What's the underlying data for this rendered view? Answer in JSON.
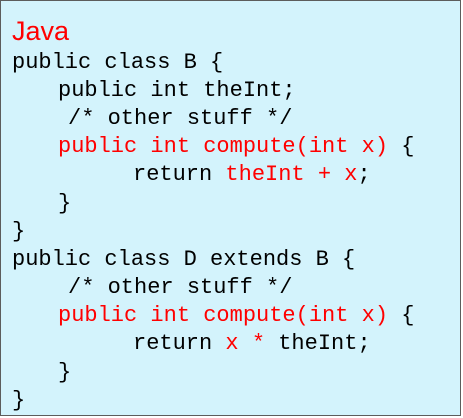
{
  "heading": "Java",
  "colors": {
    "background": "#d3f3fc",
    "border": "#5c5c5c",
    "highlight": "#ff0000",
    "text": "#000000"
  },
  "code_lines": [
    [
      {
        "text": "public class B {",
        "red": false
      }
    ],
    [
      {
        "text": "public int theInt;",
        "red": false
      }
    ],
    [
      {
        "text": "/* other stuff */",
        "red": false
      }
    ],
    [
      {
        "text": "public int compute(int x)",
        "red": true
      },
      {
        "text": " {",
        "red": false
      }
    ],
    [
      {
        "text": "return ",
        "red": false
      },
      {
        "text": "theInt + x",
        "red": true
      },
      {
        "text": ";",
        "red": false
      }
    ],
    [
      {
        "text": "}",
        "red": false
      }
    ],
    [
      {
        "text": "}",
        "red": false
      }
    ],
    [
      {
        "text": "public class D extends B {",
        "red": false
      }
    ],
    [
      {
        "text": "/* other stuff */",
        "red": false
      }
    ],
    [
      {
        "text": "public int compute(int x)",
        "red": true
      },
      {
        "text": " {",
        "red": false
      }
    ],
    [
      {
        "text": "return ",
        "red": false
      },
      {
        "text": "x * ",
        "red": true
      },
      {
        "text": "theInt;",
        "red": false
      }
    ],
    [
      {
        "text": "}",
        "red": false
      }
    ],
    [
      {
        "text": "}",
        "red": false
      }
    ]
  ]
}
